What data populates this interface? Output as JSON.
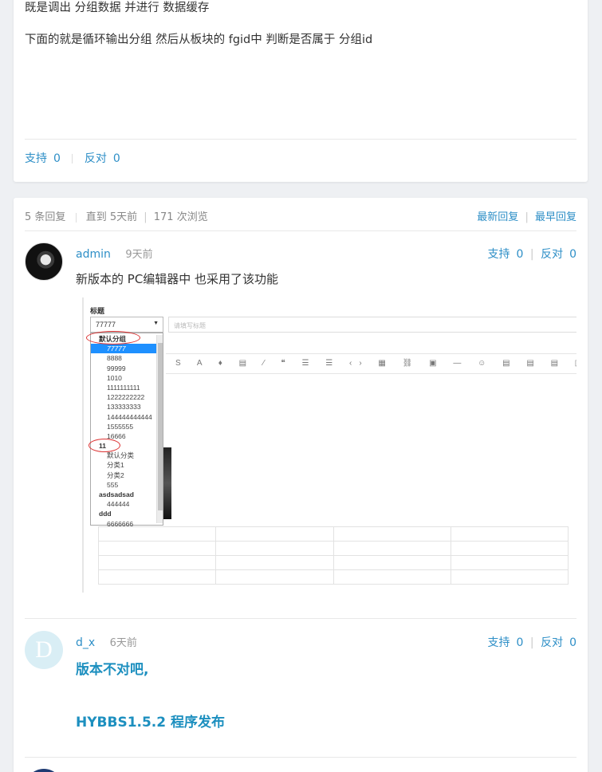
{
  "post": {
    "line1": "既是调出 分组数据 并进行 数据缓存",
    "line2": "下面的就是循环输出分组  然后从板块的 fgid中 判断是否属于 分组id",
    "support_label": "支持",
    "support_count": "0",
    "oppose_label": "反对",
    "oppose_count": "0"
  },
  "replies_header": {
    "reply_count": "5 条回复",
    "until": "直到 5天前",
    "views": "171 次浏览",
    "sort_newest": "最新回复",
    "sort_oldest": "最早回复"
  },
  "replies": [
    {
      "author": "admin",
      "time": "9天前",
      "support_label": "支持",
      "support_count": "0",
      "oppose_label": "反对",
      "oppose_count": "0",
      "content": "新版本的 PC编辑器中 也采用了该功能",
      "screenshot": {
        "field_label": "标题",
        "select_value": "77777",
        "title_placeholder": "请填写标题",
        "toolbar": "S A ♦ ▤ ⁄ ❝ ☰ ☰ ‹› ▦ ⛓ ▣ — ☺ ▤ ▤ ▤ ▥ ▣",
        "options": [
          {
            "text": "默认分组",
            "group": true
          },
          {
            "text": "77777",
            "highlight": true
          },
          {
            "text": "8888"
          },
          {
            "text": "99999"
          },
          {
            "text": "1010"
          },
          {
            "text": "1111111111"
          },
          {
            "text": "1222222222"
          },
          {
            "text": "133333333"
          },
          {
            "text": "144444444444"
          },
          {
            "text": "1555555"
          },
          {
            "text": "16666"
          },
          {
            "text": "11",
            "group": true
          },
          {
            "text": "默认分类"
          },
          {
            "text": "分类1"
          },
          {
            "text": "分类2"
          },
          {
            "text": "555"
          },
          {
            "text": "asdsadsad",
            "group": true
          },
          {
            "text": "444444"
          },
          {
            "text": "ddd",
            "group": true
          },
          {
            "text": "6666666"
          }
        ]
      }
    },
    {
      "author": "d_x",
      "time": "6天前",
      "avatar_letter": "D",
      "support_label": "支持",
      "support_count": "0",
      "oppose_label": "反对",
      "oppose_count": "0",
      "content": "版本不对吧,",
      "link": "HYBBS1.5.2 程序发布"
    }
  ]
}
